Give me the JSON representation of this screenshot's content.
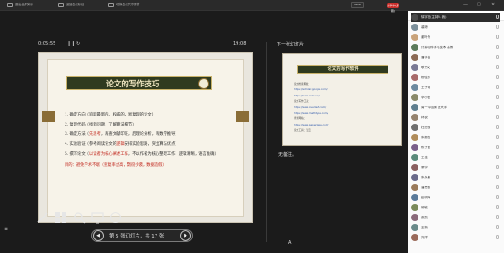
{
  "window": {
    "tabs": [
      "退出全屏演示",
      "返回会议标记",
      "切换会议共享屏幕"
    ],
    "status_box_1": "TEXE",
    "status_badge": "共享中(屏幕)",
    "min_btn": "—",
    "max_btn": "□",
    "close_btn": "✕"
  },
  "presenter": {
    "elapsed": "0:05:55",
    "clock": "19:08",
    "next_label": "下一张幻灯片",
    "notes": "无备注。",
    "nav_text": "第 5 张幻灯片，共 17 张",
    "left_mark": "≡"
  },
  "slide": {
    "title": "论文的写作技巧",
    "items": [
      {
        "text": "1. 确定方向（追踪最新的、权威的、易复现的论文）"
      },
      {
        "text": "2. 复现代码（找到问题，了解算法细节）"
      },
      {
        "prefix": "3. 确定方法（",
        "highlight": "先思考",
        "suffix": "，再查文献印证，后理论分析，再数学推导）"
      },
      {
        "prefix": "4. 实验验证（参考阅读论文的",
        "highlight": "逻辑",
        "suffix": "安排实验思路，突出算法优点）"
      },
      {
        "prefix": "5. 撰写论文（",
        "highlight": "以读者为核心阐述工作",
        "suffix": "，不以作者为核心整理工作，逻辑清晰，语言准确）"
      }
    ],
    "footer": "目的：避免学术不端（重复率过高，剽窃抄袭，数据造假）"
  },
  "next_slide": {
    "title": "论文的写作软件",
    "lines": [
      {
        "text": "论文检索网站：",
        "color": "dark"
      },
      {
        "text": "https://scholar.google.com/",
        "color": "blue"
      },
      {
        "text": "https://www.cnki.net/",
        "color": "blue"
      },
      {
        "text": "论文写作工具：",
        "color": "dark"
      },
      {
        "text": "https://www.overleaf.com/",
        "color": "blue"
      },
      {
        "text": "https://www.mathtype.com/",
        "color": "blue"
      },
      {
        "text": "查重网站：",
        "color": "dark"
      },
      {
        "text": "https://www.paperpass.com/",
        "color": "blue"
      },
      {
        "text": "论文工具：知云",
        "color": "dark"
      }
    ]
  },
  "panel": {
    "header": "参与者",
    "participants": [
      {
        "name": "徐宇阳(主持人 我)",
        "color": "#4a4a4a",
        "selected": true
      },
      {
        "name": "裴琼",
        "color": "#7b8f9a"
      },
      {
        "name": "谢叶舟",
        "color": "#c9a37a"
      },
      {
        "name": "计算机科学与技术 高博",
        "color": "#5b7a5a"
      },
      {
        "name": "潘宇浩",
        "color": "#8c6b55"
      },
      {
        "name": "耿书文",
        "color": "#7a7a95"
      },
      {
        "name": "杨佳乐",
        "color": "#a86a6a"
      },
      {
        "name": "王子玥",
        "color": "#6c8aa0"
      },
      {
        "name": "李小龙",
        "color": "#8a8a6a"
      },
      {
        "name": "周一 中国矿业大学",
        "color": "#5f7f8f"
      },
      {
        "name": "林锐",
        "color": "#95836e"
      },
      {
        "name": "杜思远",
        "color": "#6f6f6f"
      },
      {
        "name": "朱振峰",
        "color": "#b08c5a"
      },
      {
        "name": "陈子墨",
        "color": "#7a5f8a"
      },
      {
        "name": "王佳",
        "color": "#5a8a7a"
      },
      {
        "name": "董宇",
        "color": "#8a5f5f"
      },
      {
        "name": "朱永康",
        "color": "#6a6a8a"
      },
      {
        "name": "潘思嘉",
        "color": "#9a7a5a"
      },
      {
        "name": "赵明辉",
        "color": "#5a7a9a"
      },
      {
        "name": "胡敏",
        "color": "#7a8a5a"
      },
      {
        "name": "张凯",
        "color": "#8a6a7a"
      },
      {
        "name": "王新",
        "color": "#6a8a8a"
      },
      {
        "name": "刘洋",
        "color": "#9a6a5a"
      }
    ]
  }
}
